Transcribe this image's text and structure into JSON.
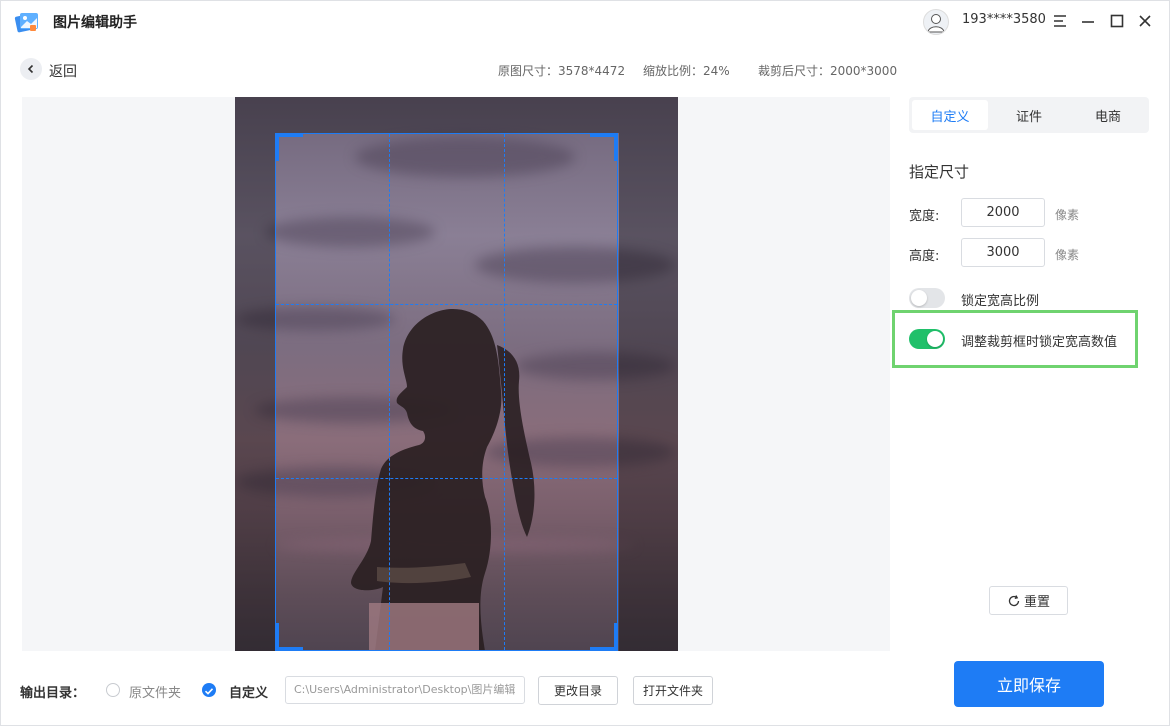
{
  "app": {
    "title": "图片编辑助手",
    "icon": "app-logo-icon"
  },
  "user": {
    "phone": "193****3580",
    "avatar_icon": "user-avatar-icon"
  },
  "window_controls": [
    "menu-icon",
    "minimize-icon",
    "maximize-icon",
    "close-icon"
  ],
  "header": {
    "back_label": "返回",
    "original_size": "原图尺寸：3578*4472",
    "zoom_ratio": "缩放比例：24%",
    "cropped_size": "裁剪后尺寸：2000*3000"
  },
  "panel": {
    "tabs": [
      {
        "label": "自定义",
        "active": true
      },
      {
        "label": "证件",
        "active": false
      },
      {
        "label": "电商",
        "active": false
      }
    ],
    "section_title": "指定尺寸",
    "width": {
      "label": "宽度:",
      "value": "2000",
      "unit": "像素"
    },
    "height": {
      "label": "高度:",
      "value": "3000",
      "unit": "像素"
    },
    "lock_ratio": {
      "label": "锁定宽高比例",
      "on": false
    },
    "lock_values": {
      "label": "调整裁剪框时锁定宽高数值",
      "on": true
    },
    "reset_label": "重置"
  },
  "bottom": {
    "output_label": "输出目录：",
    "option_original": "原文件夹",
    "option_custom": "自定义",
    "selected": "自定义",
    "path": "C:\\Users\\Administrator\\Desktop\\图片编辑",
    "change_dir": "更改目录",
    "open_folder": "打开文件夹",
    "save": "立即保存"
  },
  "colors": {
    "accent": "#1e7cf5",
    "toggle_on": "#20c06a",
    "highlight": "#6fd36f"
  }
}
